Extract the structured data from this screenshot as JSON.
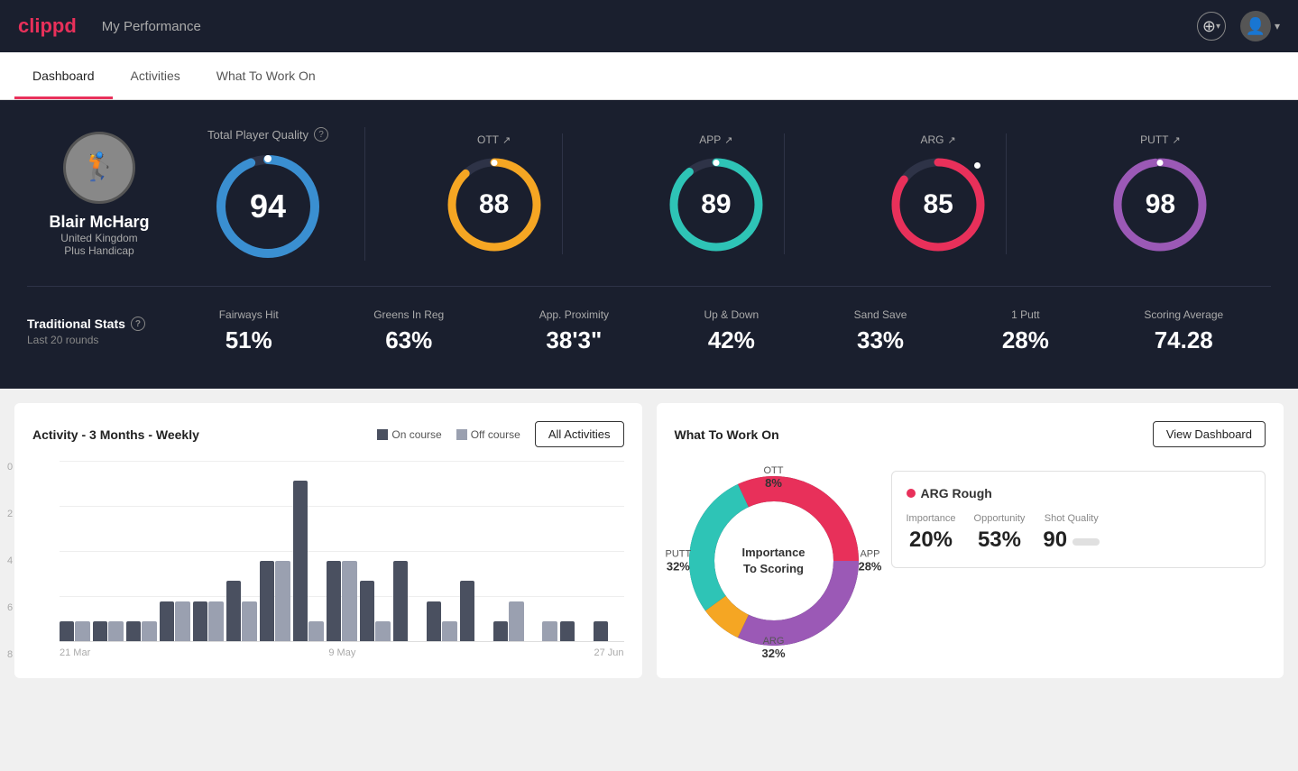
{
  "app": {
    "logo": "clippd",
    "title": "My Performance"
  },
  "header": {
    "title": "My Performance",
    "add_button_label": "+",
    "avatar_chevron": "▾"
  },
  "tabs": [
    {
      "id": "dashboard",
      "label": "Dashboard",
      "active": true
    },
    {
      "id": "activities",
      "label": "Activities",
      "active": false
    },
    {
      "id": "what-to-work-on",
      "label": "What To Work On",
      "active": false
    }
  ],
  "player": {
    "name": "Blair McHarg",
    "country": "United Kingdom",
    "handicap": "Plus Handicap",
    "avatar_emoji": "🏌️"
  },
  "total_quality": {
    "label": "Total Player Quality",
    "value": 94,
    "color": "#3a8fd1",
    "percent": 94
  },
  "metrics": [
    {
      "id": "ott",
      "label": "OTT",
      "value": 88,
      "color": "#f5a623",
      "percent": 88
    },
    {
      "id": "app",
      "label": "APP",
      "value": 89,
      "color": "#2ec4b6",
      "percent": 89
    },
    {
      "id": "arg",
      "label": "ARG",
      "value": 85,
      "color": "#e8305a",
      "percent": 85
    },
    {
      "id": "putt",
      "label": "PUTT",
      "value": 98,
      "color": "#9b59b6",
      "percent": 98
    }
  ],
  "traditional_stats": {
    "title": "Traditional Stats",
    "subtitle": "Last 20 rounds",
    "items": [
      {
        "name": "Fairways Hit",
        "value": "51%"
      },
      {
        "name": "Greens In Reg",
        "value": "63%"
      },
      {
        "name": "App. Proximity",
        "value": "38'3\""
      },
      {
        "name": "Up & Down",
        "value": "42%"
      },
      {
        "name": "Sand Save",
        "value": "33%"
      },
      {
        "name": "1 Putt",
        "value": "28%"
      },
      {
        "name": "Scoring Average",
        "value": "74.28"
      }
    ]
  },
  "activity_chart": {
    "title": "Activity - 3 Months - Weekly",
    "legend": [
      {
        "id": "on-course",
        "label": "On course",
        "color": "#4a5060"
      },
      {
        "id": "off-course",
        "label": "Off course",
        "color": "#9aa0b0"
      }
    ],
    "all_activities_btn": "All Activities",
    "x_labels": [
      "21 Mar",
      "9 May",
      "27 Jun"
    ],
    "y_labels": [
      "0",
      "2",
      "4",
      "6",
      "8"
    ],
    "bars": [
      {
        "on": 1,
        "off": 1
      },
      {
        "on": 1,
        "off": 1
      },
      {
        "on": 1,
        "off": 1
      },
      {
        "on": 2,
        "off": 2
      },
      {
        "on": 2,
        "off": 2
      },
      {
        "on": 3,
        "off": 2
      },
      {
        "on": 4,
        "off": 4
      },
      {
        "on": 8,
        "off": 1
      },
      {
        "on": 4,
        "off": 4
      },
      {
        "on": 3,
        "off": 1
      },
      {
        "on": 4,
        "off": 0
      },
      {
        "on": 2,
        "off": 1
      },
      {
        "on": 3,
        "off": 0
      },
      {
        "on": 1,
        "off": 2
      },
      {
        "on": 0,
        "off": 1
      },
      {
        "on": 1,
        "off": 0
      },
      {
        "on": 1,
        "off": 0
      }
    ]
  },
  "what_to_work_on": {
    "title": "What To Work On",
    "view_dashboard_btn": "View Dashboard",
    "donut_center": "Importance\nTo Scoring",
    "segments": [
      {
        "id": "ott",
        "label": "OTT",
        "value": 8,
        "color": "#f5a623"
      },
      {
        "id": "app",
        "label": "APP",
        "value": 28,
        "color": "#2ec4b6"
      },
      {
        "id": "arg",
        "label": "ARG",
        "value": 32,
        "color": "#e8305a"
      },
      {
        "id": "putt",
        "label": "PUTT",
        "value": 32,
        "color": "#9b59b6"
      }
    ],
    "detail_card": {
      "title": "ARG Rough",
      "dot_color": "#e8305a",
      "metrics": [
        {
          "label": "Importance",
          "value": "20%"
        },
        {
          "label": "Opportunity",
          "value": "53%"
        },
        {
          "label": "Shot Quality",
          "value": "90"
        }
      ]
    }
  }
}
